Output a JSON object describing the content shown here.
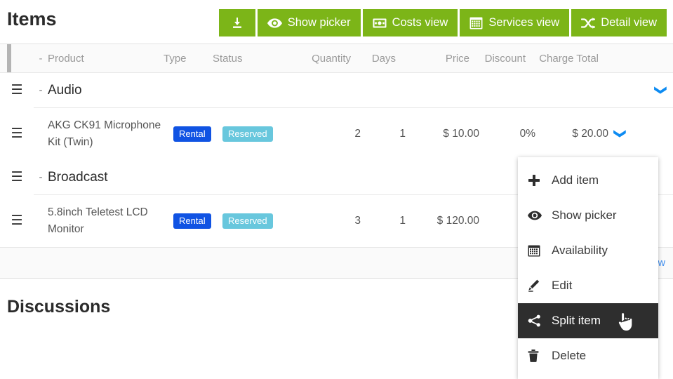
{
  "header": {
    "title": "Items",
    "toolbar": [
      {
        "id": "download",
        "label": "",
        "icon": "download-icon",
        "icon_only": true
      },
      {
        "id": "show-picker",
        "label": "Show picker",
        "icon": "eye-icon",
        "icon_only": false
      },
      {
        "id": "costs-view",
        "label": "Costs view",
        "icon": "money-icon",
        "icon_only": false
      },
      {
        "id": "services-view",
        "label": "Services view",
        "icon": "calendar-icon",
        "icon_only": false
      },
      {
        "id": "detail-view",
        "label": "Detail view",
        "icon": "shuffle-icon",
        "icon_only": false
      }
    ],
    "accent_green": "#7cb518"
  },
  "table": {
    "columns": {
      "grip": "",
      "dash": "-",
      "product": "Product",
      "type": "Type",
      "status": "Status",
      "quantity": "Quantity",
      "days": "Days",
      "price": "Price",
      "discount": "Discount",
      "charge_total": "Charge Total"
    },
    "groups": [
      {
        "name": "Audio",
        "dash": "-",
        "grip": "☰",
        "caret": "❯",
        "rows": [
          {
            "grip": "☰",
            "product": "AKG CK91 Microphone Kit (Twin)",
            "type": "Rental",
            "status": "Reserved",
            "quantity": "2",
            "days": "1",
            "price": "$ 10.00",
            "discount": "0%",
            "charge_total": "$ 20.00",
            "caret": "❯"
          }
        ]
      },
      {
        "name": "Broadcast",
        "dash": "-",
        "grip": "☰",
        "caret": "",
        "rows": [
          {
            "grip": "☰",
            "product": "5.8inch Teletest LCD Monitor",
            "type": "Rental",
            "status": "Reserved",
            "quantity": "3",
            "days": "1",
            "price": "$ 120.00",
            "discount": "",
            "charge_total": "",
            "caret": ""
          }
        ]
      }
    ],
    "footer": {
      "add_new_label": "Add a new"
    },
    "badge_colors": {
      "rental": "#1053e3",
      "reserved": "#68c7dd"
    }
  },
  "context_menu": {
    "items": [
      {
        "label": "Add item",
        "icon": "plus-icon",
        "active": false
      },
      {
        "label": "Show picker",
        "icon": "eye-icon",
        "active": false
      },
      {
        "label": "Availability",
        "icon": "calendar-icon",
        "active": false
      },
      {
        "label": "Edit",
        "icon": "pencil-icon",
        "active": false
      },
      {
        "label": "Split item",
        "icon": "share-icon",
        "active": true
      },
      {
        "label": "Delete",
        "icon": "trash-icon",
        "active": false
      }
    ],
    "highlight_color": "#2e2e2e"
  },
  "discussions": {
    "heading": "Discussions"
  }
}
